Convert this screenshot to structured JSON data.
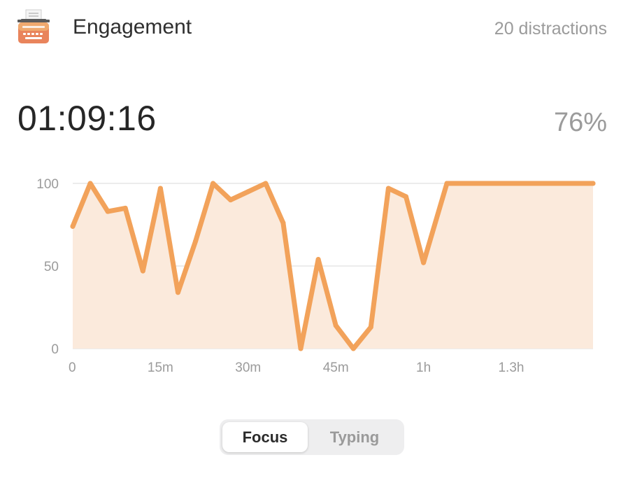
{
  "header": {
    "icon": "typewriter-icon",
    "title": "Engagement",
    "distractions": "20 distractions"
  },
  "summary": {
    "duration": "01:09:16",
    "score": "76%"
  },
  "colors": {
    "line": "#f2a25a",
    "fill": "#fbeadc",
    "grid": "#e6e6e6",
    "axis_text": "#9b9b9b"
  },
  "chart_data": {
    "type": "area",
    "title": "",
    "xlabel": "",
    "ylabel": "",
    "ylim": [
      0,
      100
    ],
    "yticks": [
      0,
      50,
      100
    ],
    "ytick_labels": [
      "0",
      "50",
      "100"
    ],
    "xlim": [
      0,
      89
    ],
    "xticks": [
      0,
      15,
      30,
      45,
      60,
      75
    ],
    "xtick_labels": [
      "0",
      "15m",
      "30m",
      "45m",
      "1h",
      "1.3h"
    ],
    "grid": true,
    "series": [
      {
        "x": [
          0,
          3,
          6,
          9,
          12,
          15,
          18,
          21,
          24,
          27,
          30,
          33,
          36,
          39,
          42,
          45,
          48,
          51,
          54,
          57,
          60,
          64,
          67,
          70,
          73,
          76,
          79,
          82,
          85,
          89
        ],
        "values": [
          74,
          100,
          83,
          85,
          47,
          97,
          34,
          65,
          100,
          90,
          95,
          100,
          76,
          0,
          54,
          14,
          0,
          13,
          97,
          92,
          52,
          100,
          100,
          100,
          100,
          100,
          100,
          100,
          100,
          100
        ]
      }
    ]
  },
  "mode_toggle": {
    "options": [
      "Focus",
      "Typing"
    ],
    "selected": "Focus"
  }
}
